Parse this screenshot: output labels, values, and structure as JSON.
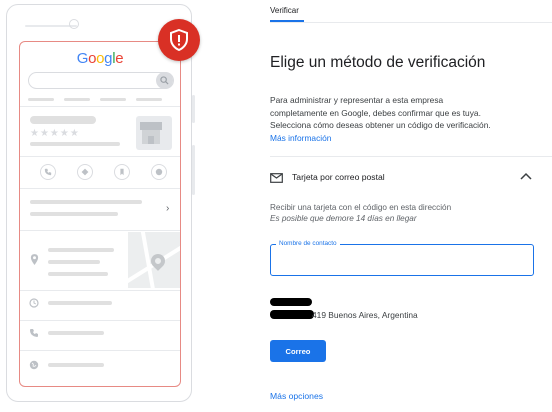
{
  "illustration": {
    "logo_letters": [
      "G",
      "o",
      "o",
      "g",
      "l",
      "e"
    ],
    "logo_colors": [
      "#4285f4",
      "#ea4335",
      "#fbbc05",
      "#4285f4",
      "#34a853",
      "#ea4335"
    ],
    "icons": [
      "search-icon",
      "shop-icon",
      "phone-icon",
      "directions-icon",
      "bookmark-icon",
      "share-icon",
      "map-pin-icon",
      "clock-icon",
      "globe-icon",
      "shield-alert-icon"
    ],
    "accent_color": "#d93025",
    "outline_color": "#e78a84"
  },
  "nav": {
    "breadcrumb": "Verificar"
  },
  "main": {
    "title": "Elige un método de verificación",
    "description_lines": [
      "Para administrar y representar a esta empresa",
      "completamente en Google, debes confirmar que es tuya.",
      "Selecciona cómo deseas obtener un código de verificación."
    ],
    "more_info_link": "Más información"
  },
  "option": {
    "title": "Tarjeta por correo postal",
    "description": "Recibir una tarjeta con el código en esta dirección",
    "note": "Es posible que demore 14 días en llegar",
    "contact_field": {
      "label": "Nombre de contacto",
      "value": ""
    },
    "address": "419 Buenos Aires, Argentina",
    "submit_label": "Correo"
  },
  "footer": {
    "more_options": "Más opciones"
  },
  "colors": {
    "primary": "#1a73e8",
    "text": "#202124",
    "muted": "#5f6368"
  }
}
